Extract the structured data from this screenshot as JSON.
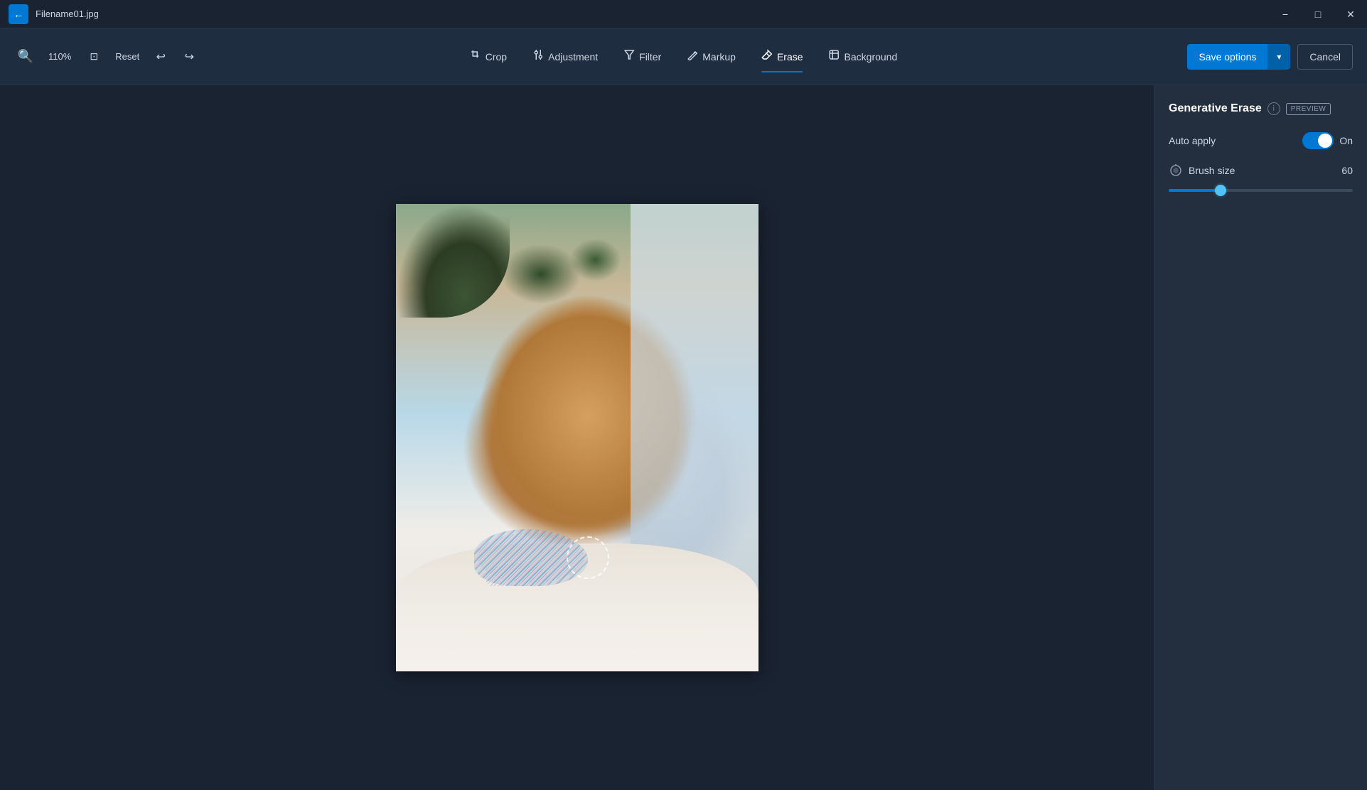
{
  "titleBar": {
    "filename": "Filename01.jpg",
    "backIcon": "←",
    "controls": {
      "minimize": "−",
      "maximize": "□",
      "close": "✕"
    }
  },
  "toolbar": {
    "zoomOut": "−",
    "zoomIn": "+",
    "fitView": "⊡",
    "zoomLevel": "110%",
    "reset": "Reset",
    "undo": "↩",
    "redo": "↪",
    "tools": [
      {
        "id": "crop",
        "label": "Crop",
        "icon": "⊡"
      },
      {
        "id": "adjustment",
        "label": "Adjustment",
        "icon": "⚙"
      },
      {
        "id": "filter",
        "label": "Filter",
        "icon": "◈"
      },
      {
        "id": "markup",
        "label": "Markup",
        "icon": "✎"
      },
      {
        "id": "erase",
        "label": "Erase",
        "icon": "◻",
        "active": true
      },
      {
        "id": "background",
        "label": "Background",
        "icon": "⬡"
      }
    ],
    "saveOptions": "Save options",
    "dropdownIcon": "▾",
    "cancel": "Cancel"
  },
  "panel": {
    "title": "Generative Erase",
    "infoIcon": "i",
    "previewBadge": "PREVIEW",
    "autoApply": {
      "label": "Auto apply",
      "state": "On",
      "enabled": true
    },
    "brushSize": {
      "label": "Brush size",
      "value": 60,
      "min": 1,
      "max": 100,
      "percent": 28
    }
  },
  "colors": {
    "accent": "#0078d4",
    "activeTab": "#0078d4",
    "toggleActive": "#0078d4",
    "thumbColor": "#4fc3f7",
    "background": "#1a2332",
    "panelBg": "#232f3e",
    "toolbarBg": "#1e2d3f"
  }
}
